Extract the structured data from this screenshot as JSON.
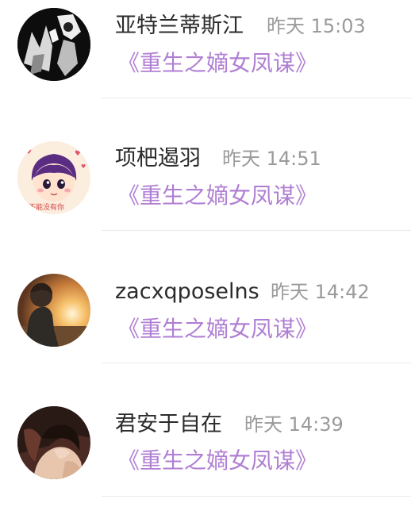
{
  "colors": {
    "name": "#2b2b2b",
    "timestamp": "#9a9a9a",
    "book_title": "#b07fd3",
    "divider": "#ececec"
  },
  "items": [
    {
      "user": "亚特兰蒂斯江",
      "time": "昨天 15:03",
      "book": "《重生之嫡女凤谋》",
      "avatar_icon": "user-avatar-monochrome-photo"
    },
    {
      "user": "项杷遏羽",
      "time": "昨天 14:51",
      "book": "《重生之嫡女凤谋》",
      "avatar_icon": "user-avatar-cartoon-boy",
      "avatar_text": "不能没有你"
    },
    {
      "user": "zacxqposelns",
      "time": "昨天 14:42",
      "book": "《重生之嫡女凤谋》",
      "avatar_icon": "user-avatar-sunset-silhouette"
    },
    {
      "user": "君安于自在",
      "time": "昨天 14:39",
      "book": "《重生之嫡女凤谋》",
      "avatar_icon": "user-avatar-anime-couple"
    }
  ]
}
